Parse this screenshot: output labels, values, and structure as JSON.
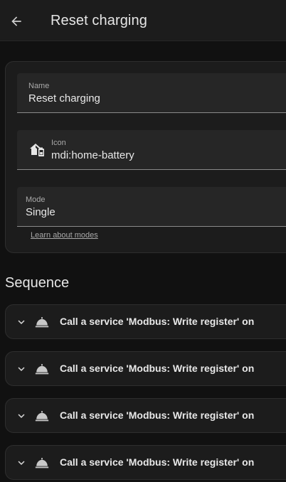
{
  "header": {
    "title": "Reset charging",
    "back_icon": "arrow-left-icon"
  },
  "form": {
    "name": {
      "label": "Name",
      "value": "Reset charging"
    },
    "icon": {
      "label": "Icon",
      "value": "mdi:home-battery",
      "icon_name": "home-battery-icon"
    },
    "mode": {
      "label": "Mode",
      "value": "Single"
    },
    "learn_link": "Learn about modes"
  },
  "sequence": {
    "title": "Sequence",
    "items": [
      {
        "label": "Call a service 'Modbus: Write register' on",
        "icon": "service-bell-icon"
      },
      {
        "label": "Call a service 'Modbus: Write register' on",
        "icon": "service-bell-icon"
      },
      {
        "label": "Call a service 'Modbus: Write register' on",
        "icon": "service-bell-icon"
      },
      {
        "label": "Call a service 'Modbus: Write register' on",
        "icon": "service-bell-icon"
      }
    ]
  }
}
